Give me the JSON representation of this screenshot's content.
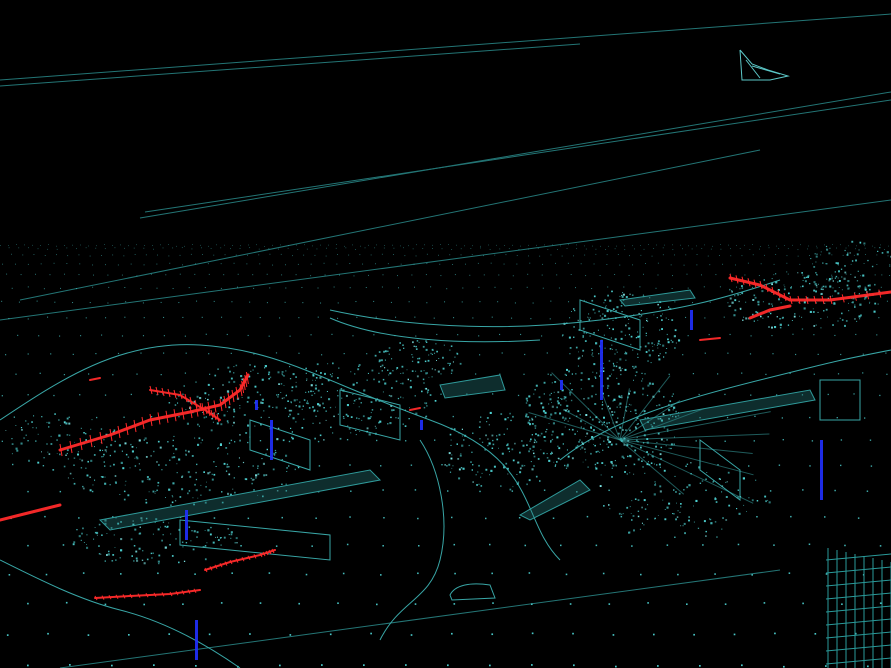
{
  "scene": {
    "kind": "point-cloud-wireframe",
    "background": "#000000",
    "colors": {
      "grid_dots": "#4fd6d6",
      "wireframe": "#3fb8b8",
      "wireframe_bright": "#7fe8e8",
      "highlight_red": "#ff2a2a",
      "highlight_blue": "#2030ff"
    },
    "icons": [
      "ground-grid",
      "road-outlines",
      "vehicle-wireframes",
      "building-wireframe",
      "red-trajectories",
      "blue-markers"
    ]
  }
}
